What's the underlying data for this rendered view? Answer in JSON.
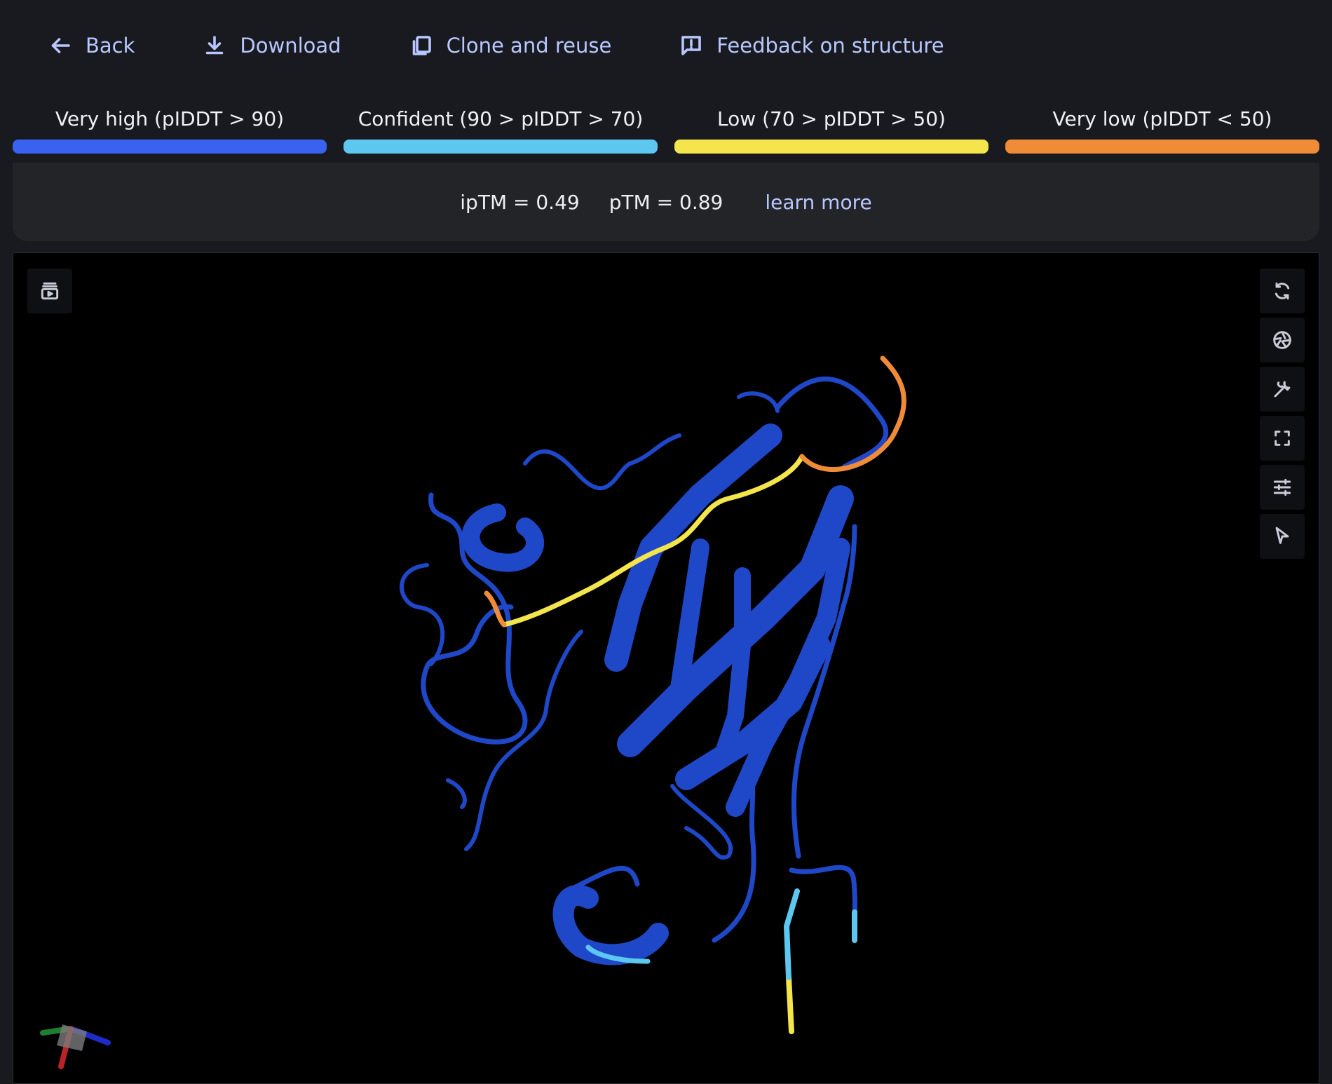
{
  "toolbar": {
    "back_label": "Back",
    "download_label": "Download",
    "clone_label": "Clone and reuse",
    "feedback_label": "Feedback on structure",
    "accent_color": "#b9c7ff"
  },
  "legend": [
    {
      "label": "Very high (pIDDT > 90)",
      "color": "#3a62f0"
    },
    {
      "label": "Confident (90 > pIDDT > 70)",
      "color": "#5dc7ef"
    },
    {
      "label": "Low (70 > pIDDT > 50)",
      "color": "#f3e54b"
    },
    {
      "label": "Very low (pIDDT < 50)",
      "color": "#f08b37"
    }
  ],
  "metrics": {
    "iptm": "ipTM = 0.49",
    "ptm": "pTM = 0.89",
    "learn_more": "learn more"
  },
  "viewer": {
    "left_tool_icon": "sequence-viewer-icon",
    "right_tools": [
      {
        "name": "rotate-icon"
      },
      {
        "name": "camera-icon"
      },
      {
        "name": "wrench-icon"
      },
      {
        "name": "fullscreen-icon"
      },
      {
        "name": "settings-icon"
      },
      {
        "name": "select-cursor-icon"
      }
    ],
    "structure_colors": {
      "very_high": "#1f48c9",
      "confident": "#5dc7ef",
      "low": "#f3e54b",
      "very_low": "#f08b37"
    }
  }
}
